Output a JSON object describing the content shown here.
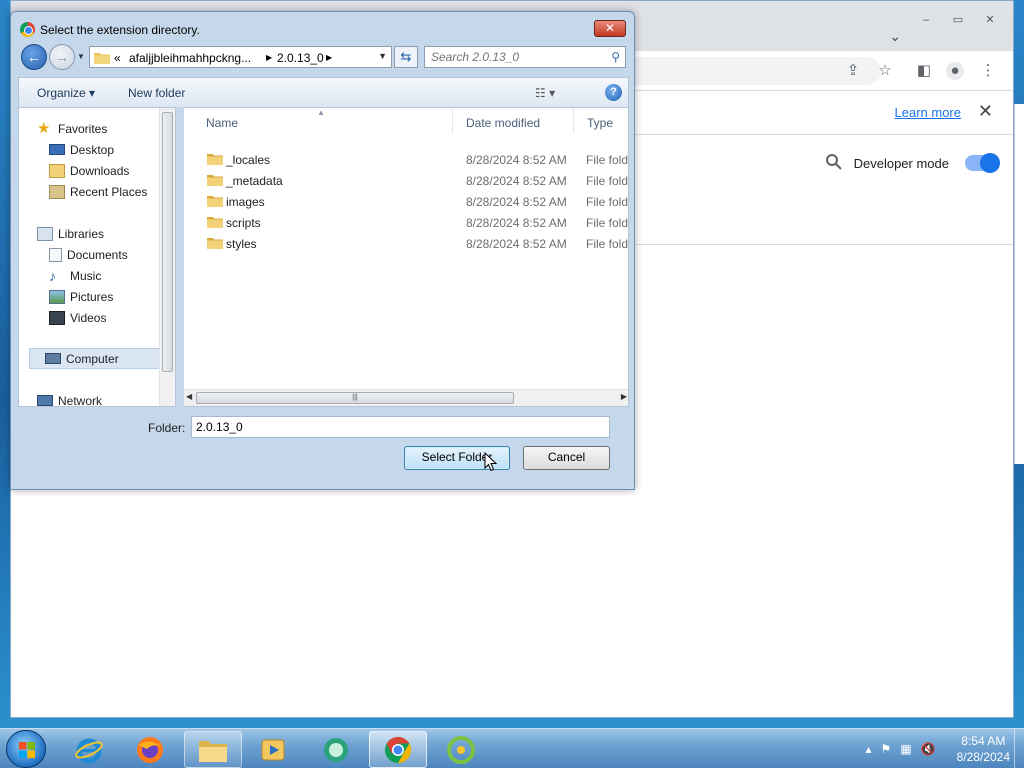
{
  "browser": {
    "banner_link": "Learn more",
    "dev_mode_label": "Developer mode",
    "dev_mode_on": true,
    "window_controls": [
      "–",
      "▭",
      "✕"
    ]
  },
  "dialog": {
    "title": "Select the extension directory.",
    "close_label": "✕",
    "breadcrumb": {
      "overflow": "«",
      "parent": "afaljjbleihmahhpckng...",
      "current": "2.0.13_0"
    },
    "search_placeholder": "Search 2.0.13_0",
    "toolbar": {
      "organize": "Organize",
      "new_folder": "New folder",
      "help": "?"
    },
    "nav": {
      "favorites": "Favorites",
      "desktop": "Desktop",
      "downloads": "Downloads",
      "recent_places": "Recent Places",
      "libraries": "Libraries",
      "documents": "Documents",
      "music": "Music",
      "pictures": "Pictures",
      "videos": "Videos",
      "computer": "Computer",
      "network": "Network"
    },
    "columns": {
      "name": "Name",
      "date_modified": "Date modified",
      "type": "Type"
    },
    "files": [
      {
        "name": "_locales",
        "date": "8/28/2024 8:52 AM",
        "type": "File folder"
      },
      {
        "name": "_metadata",
        "date": "8/28/2024 8:52 AM",
        "type": "File folder"
      },
      {
        "name": "images",
        "date": "8/28/2024 8:52 AM",
        "type": "File folder"
      },
      {
        "name": "scripts",
        "date": "8/28/2024 8:52 AM",
        "type": "File folder"
      },
      {
        "name": "styles",
        "date": "8/28/2024 8:52 AM",
        "type": "File folder"
      }
    ],
    "folder_label": "Folder:",
    "folder_value": "2.0.13_0",
    "select_button": "Select Folder",
    "cancel_button": "Cancel"
  },
  "taskbar": {
    "apps": [
      "internet-explorer",
      "firefox",
      "file-explorer",
      "media-player",
      "app-green",
      "chrome",
      "app-yellow"
    ],
    "clock_time": "8:54 AM",
    "clock_date": "8/28/2024"
  },
  "colors": {
    "accent": "#1a73e8",
    "dialog_frame": "#c5d7ea",
    "taskbar": "#4d86bf"
  }
}
